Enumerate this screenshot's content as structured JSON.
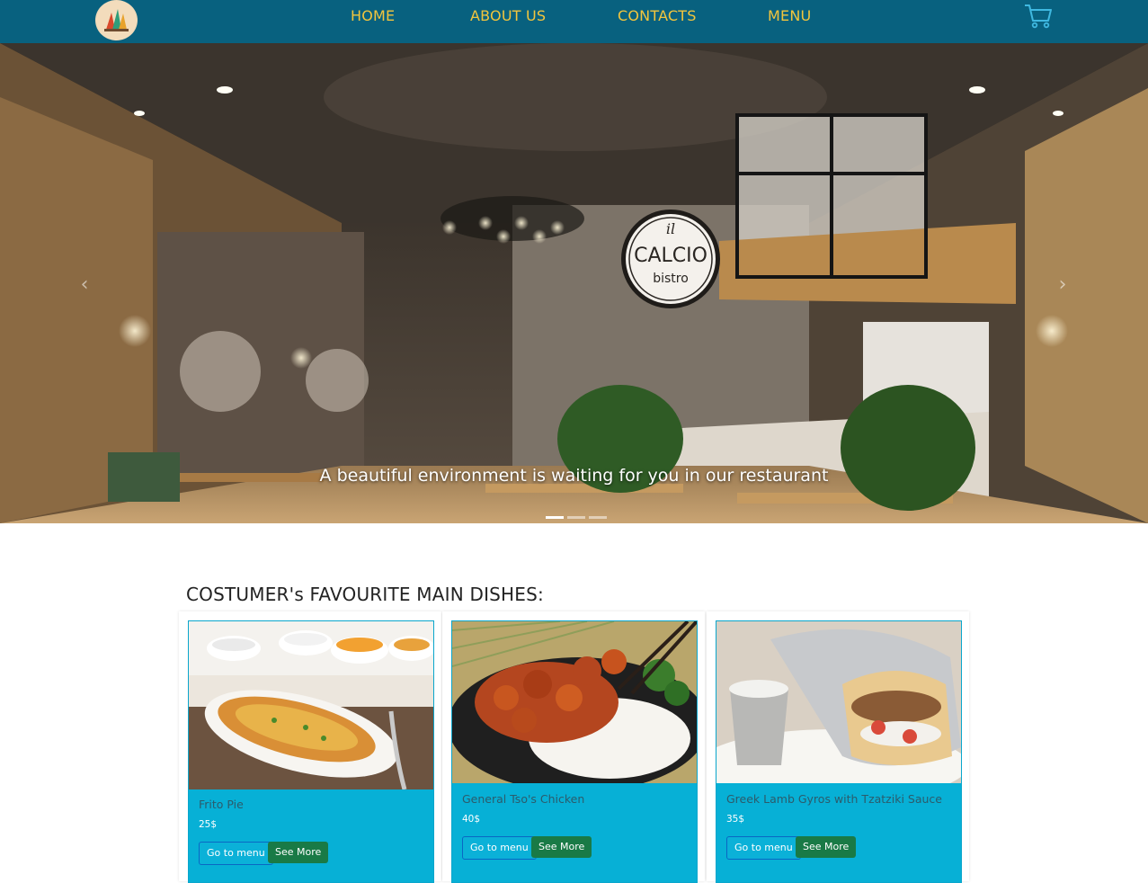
{
  "nav": {
    "links": [
      "HOME",
      "ABOUT US",
      "CONTACTS",
      "MENU"
    ]
  },
  "hero": {
    "caption": "A beautiful environment is waiting for you in our restaurant",
    "sign_line1": "il",
    "sign_line2": "CALCIO",
    "sign_line3": "bistro",
    "slides": 3,
    "active_slide": 1
  },
  "section": {
    "title": "COSTUMER's FAVOURITE MAIN DISHES:"
  },
  "dishes": [
    {
      "name": "Frito Pie",
      "price": "25$",
      "menu_label": "Go to menu",
      "more_label": "See More"
    },
    {
      "name": "General Tso's Chicken",
      "price": "40$",
      "menu_label": "Go to menu",
      "more_label": "See More"
    },
    {
      "name": "Greek Lamb Gyros with Tzatziki Sauce",
      "price": "35$",
      "menu_label": "Go to menu",
      "more_label": "See More"
    }
  ],
  "colors": {
    "navbar": "#08617f",
    "nav_link": "#f2c53d",
    "card_body": "#07b0d6",
    "see_more": "#197a46"
  }
}
